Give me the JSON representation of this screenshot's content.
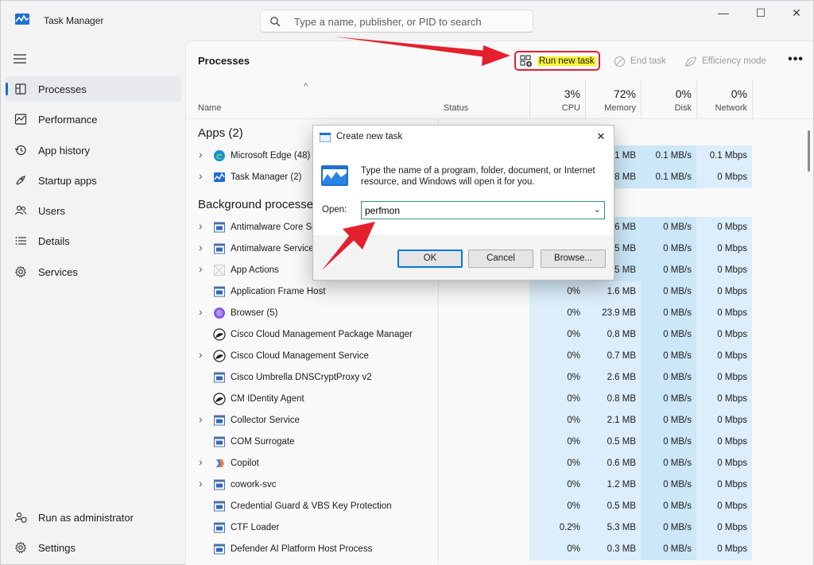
{
  "window": {
    "title": "Task Manager",
    "search_placeholder": "Type a name, publisher, or PID to search",
    "minimize_glyph": "—",
    "maximize_glyph": "☐",
    "close_glyph": "✕"
  },
  "sidebar": {
    "items": [
      {
        "label": "Processes",
        "icon": "processes-icon"
      },
      {
        "label": "Performance",
        "icon": "performance-icon"
      },
      {
        "label": "App history",
        "icon": "history-icon"
      },
      {
        "label": "Startup apps",
        "icon": "startup-icon"
      },
      {
        "label": "Users",
        "icon": "users-icon"
      },
      {
        "label": "Details",
        "icon": "details-icon"
      },
      {
        "label": "Services",
        "icon": "gear-icon"
      }
    ],
    "bottom": [
      {
        "label": "Run as administrator",
        "icon": "admin-icon"
      },
      {
        "label": "Settings",
        "icon": "settings-icon"
      }
    ]
  },
  "toolbar": {
    "title": "Processes",
    "run_new_task": "Run new task",
    "end_task": "End task",
    "efficiency_mode": "Efficiency mode",
    "more": "•••"
  },
  "table": {
    "sort_arrow": "^",
    "headers": {
      "name": "Name",
      "status": "Status",
      "cpu": {
        "pct": "3%",
        "label": "CPU"
      },
      "memory": {
        "pct": "72%",
        "label": "Memory"
      },
      "disk": {
        "pct": "0%",
        "label": "Disk"
      },
      "network": {
        "pct": "0%",
        "label": "Network"
      }
    },
    "groups": {
      "apps": "Apps (2)",
      "background": "Background processes"
    },
    "rows": [
      {
        "name": "Microsoft Edge (48)",
        "cpu": "",
        "mem": "1 MB",
        "disk": "0.1 MB/s",
        "net": "0.1 Mbps"
      },
      {
        "name": "Task Manager (2)",
        "cpu": "",
        "mem": "8 MB",
        "disk": "0.1 MB/s",
        "net": "0 Mbps"
      },
      {
        "name": "Antimalware Core Se",
        "cpu": "",
        "mem": "6 MB",
        "disk": "0 MB/s",
        "net": "0 Mbps"
      },
      {
        "name": "Antimalware Service",
        "cpu": "",
        "mem": "5 MB",
        "disk": "0 MB/s",
        "net": "0 Mbps"
      },
      {
        "name": "App Actions",
        "cpu": "",
        "mem": "5 MB",
        "disk": "0 MB/s",
        "net": "0 Mbps"
      },
      {
        "name": "Application Frame Host",
        "cpu": "0%",
        "mem": "1.6 MB",
        "disk": "0 MB/s",
        "net": "0 Mbps"
      },
      {
        "name": "Browser (5)",
        "cpu": "0%",
        "mem": "23.9 MB",
        "disk": "0 MB/s",
        "net": "0 Mbps"
      },
      {
        "name": "Cisco Cloud Management Package Manager",
        "cpu": "0%",
        "mem": "0.8 MB",
        "disk": "0 MB/s",
        "net": "0 Mbps"
      },
      {
        "name": "Cisco Cloud Management Service",
        "cpu": "0%",
        "mem": "0.7 MB",
        "disk": "0 MB/s",
        "net": "0 Mbps"
      },
      {
        "name": "Cisco Umbrella DNSCryptProxy v2",
        "cpu": "0%",
        "mem": "2.6 MB",
        "disk": "0 MB/s",
        "net": "0 Mbps"
      },
      {
        "name": "CM IDentity Agent",
        "cpu": "0%",
        "mem": "0.8 MB",
        "disk": "0 MB/s",
        "net": "0 Mbps"
      },
      {
        "name": "Collector Service",
        "cpu": "0%",
        "mem": "2.1 MB",
        "disk": "0 MB/s",
        "net": "0 Mbps"
      },
      {
        "name": "COM Surrogate",
        "cpu": "0%",
        "mem": "0.5 MB",
        "disk": "0 MB/s",
        "net": "0 Mbps"
      },
      {
        "name": "Copilot",
        "cpu": "0%",
        "mem": "0.6 MB",
        "disk": "0 MB/s",
        "net": "0 Mbps"
      },
      {
        "name": "cowork-svc",
        "cpu": "0%",
        "mem": "1.2 MB",
        "disk": "0 MB/s",
        "net": "0 Mbps"
      },
      {
        "name": "Credential Guard & VBS Key Protection",
        "cpu": "0%",
        "mem": "0.5 MB",
        "disk": "0 MB/s",
        "net": "0 Mbps"
      },
      {
        "name": "CTF Loader",
        "cpu": "0.2%",
        "mem": "5.3 MB",
        "disk": "0 MB/s",
        "net": "0 Mbps"
      },
      {
        "name": "Defender AI Platform Host Process",
        "cpu": "0%",
        "mem": "0.3 MB",
        "disk": "0 MB/s",
        "net": "0 Mbps"
      }
    ]
  },
  "dialog": {
    "title": "Create new task",
    "close": "✕",
    "description": "Type the name of a program, folder, document, or Internet resource, and Windows will open it for you.",
    "open_label": "Open:",
    "open_value": "perfmon",
    "ok": "OK",
    "cancel": "Cancel",
    "browse": "Browse..."
  },
  "colors": {
    "annotation_red": "#e4202c",
    "highlight_yellow": "#f5f336",
    "accent_blue": "#1a6ad3"
  }
}
